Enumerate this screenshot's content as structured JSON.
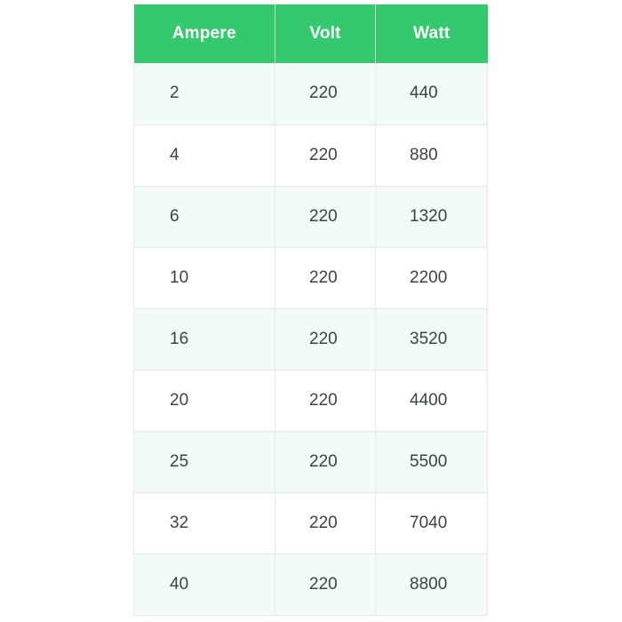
{
  "table": {
    "name": "electrical-load-table",
    "accent_color": "#33c96c",
    "header_text_color": "#ffffff",
    "cell_text_color": "#3c4245",
    "stripe_color": "#f3fbf6",
    "base_color": "#ffffff",
    "border_color": "#e6eae8",
    "columns": [
      {
        "key": "ampere",
        "label": "Ampere"
      },
      {
        "key": "volt",
        "label": "Volt"
      },
      {
        "key": "watt",
        "label": "Watt"
      }
    ],
    "rows": [
      {
        "ampere": "2",
        "volt": "220",
        "watt": "440"
      },
      {
        "ampere": "4",
        "volt": "220",
        "watt": "880"
      },
      {
        "ampere": "6",
        "volt": "220",
        "watt": "1320"
      },
      {
        "ampere": "10",
        "volt": "220",
        "watt": "2200"
      },
      {
        "ampere": "16",
        "volt": "220",
        "watt": "3520"
      },
      {
        "ampere": "20",
        "volt": "220",
        "watt": "4400"
      },
      {
        "ampere": "25",
        "volt": "220",
        "watt": "5500"
      },
      {
        "ampere": "32",
        "volt": "220",
        "watt": "7040"
      },
      {
        "ampere": "40",
        "volt": "220",
        "watt": "8800"
      }
    ]
  },
  "chart_data": {
    "type": "table",
    "title": "",
    "columns": [
      "Ampere",
      "Volt",
      "Watt"
    ],
    "rows": [
      [
        2,
        220,
        440
      ],
      [
        4,
        220,
        880
      ],
      [
        6,
        220,
        1320
      ],
      [
        10,
        220,
        2200
      ],
      [
        16,
        220,
        3520
      ],
      [
        20,
        220,
        4400
      ],
      [
        25,
        220,
        5500
      ],
      [
        32,
        220,
        7040
      ],
      [
        40,
        220,
        8800
      ]
    ],
    "xlabel": "",
    "ylabel": ""
  }
}
